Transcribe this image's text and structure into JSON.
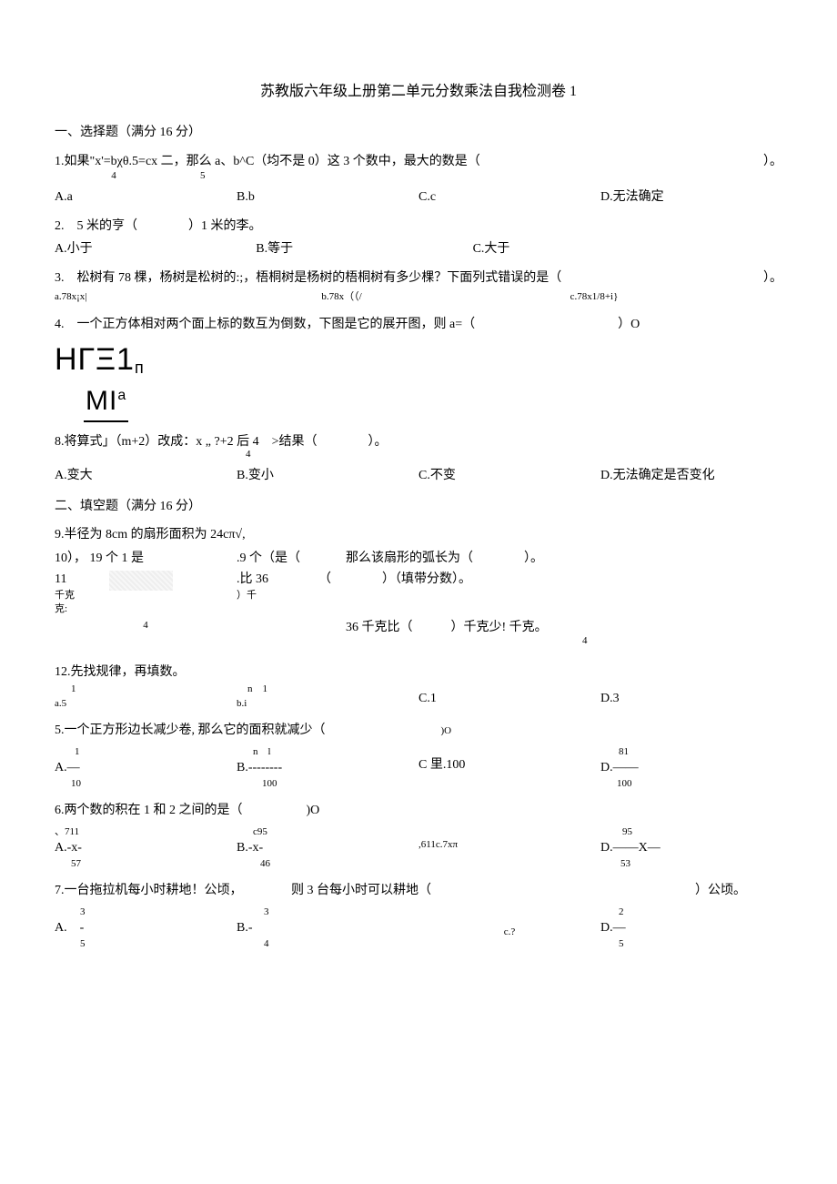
{
  "title": "苏教版六年级上册第二单元分数乘法自我检测卷 1",
  "s1": {
    "head": "一、选择题（满分 16 分）",
    "q1": {
      "text": "1.如果\"x'=bχθ.5=cx 二，那么 a、b^C（均不是 0）这 3 个数中，最大的数是（",
      "tail": "）。",
      "sub4": "4",
      "sub5": "5",
      "a": "A.a",
      "b": "B.b",
      "c": "C.c",
      "d": "D.无法确定"
    },
    "q2": {
      "text": "2.　5 米的亨（　　　　）1 米的李。",
      "a": "A.小于",
      "b": "B.等于",
      "c": "C.大于"
    },
    "q3": {
      "text": "3.　松树有 78 棵，杨树是松树的:;，梧桐树是杨树的梧桐树有多少棵？下面列式错误的是（",
      "tail": "）。",
      "a": "a.78x¡x|",
      "b": "b.78x（（/",
      "c": "c.78x1/8+i}"
    },
    "q4": {
      "text": "4.　一个正方体相对两个面上标的数互为倒数，下图是它的展开图，则 a=（",
      "tail": "）O"
    },
    "q8": {
      "text": "8.将算式」（m+2）改成：x „ ?+2 后 4　>结果（　　　　）。",
      "sub": "4",
      "a": "A.变大",
      "b": "B.变小",
      "c": "C.不变",
      "d": "D.无法确定是否变化"
    }
  },
  "s2": {
    "head": "二、填空题（满分 16 分）",
    "q9": "9.半径为 8cm 的扇形面积为 24cπ√,",
    "q9tail": "那么该扇形的弧长为（　　　　）。",
    "q10a": "10）， 19 个 1 是",
    "q10b": ".9 个（是（",
    "q11a": "11",
    "q11a2": "千克",
    "q11a3": "克:",
    "q11b": ".比 36",
    "q11b2": "）千",
    "q11c": "（　　　　）（填带分数）。",
    "q11d": "4",
    "q11e": "36 千克比（　　　）千克少! 千克。",
    "q11f": "4",
    "q12": "12.先找规律，再填数。",
    "q12a1": "1",
    "q12a2": "a.5",
    "q12b1": "n　1",
    "q12b2": "b.i",
    "q12c": "C.1",
    "q12d": "D.3",
    "q5": {
      "text": "5.一个正方形边长减少卷, 那么它的面积就减少（",
      "tail": ")O",
      "a1": "1",
      "a2": "A.—",
      "a3": "10",
      "b1": "n　l",
      "b2": "B.--------",
      "b3": "100",
      "c": "C 里.100",
      "d1": "81",
      "d2": "D.——",
      "d3": "100"
    },
    "q6": {
      "text": "6.两个数的积在 1 和 2 之间的是（　　　　　)O",
      "a1": "、711",
      "a2": "A.-x-",
      "a3": "57",
      "b1": "c95",
      "b2": "B.-x-",
      "b3": "46",
      "c": ",611c.7xπ",
      "d1": "95",
      "d2": "D.——X—",
      "d3": "53"
    },
    "q7": {
      "text": "7.一台拖拉机每小时耕地！公顷，",
      "mid": "则 3 台每小时可以耕地（",
      "tail": "）公顷。",
      "a1": "3",
      "a2": "A.　-",
      "a3": "5",
      "b1": "3",
      "b2": "B.-　",
      "b3": "4",
      "c": "c.?",
      "d1": "2",
      "d2": "D.—",
      "d3": "5"
    }
  },
  "fig": {
    "l1a": "HГΞ1",
    "l1b": "п",
    "l2a": "MI",
    "l2b": "a"
  }
}
